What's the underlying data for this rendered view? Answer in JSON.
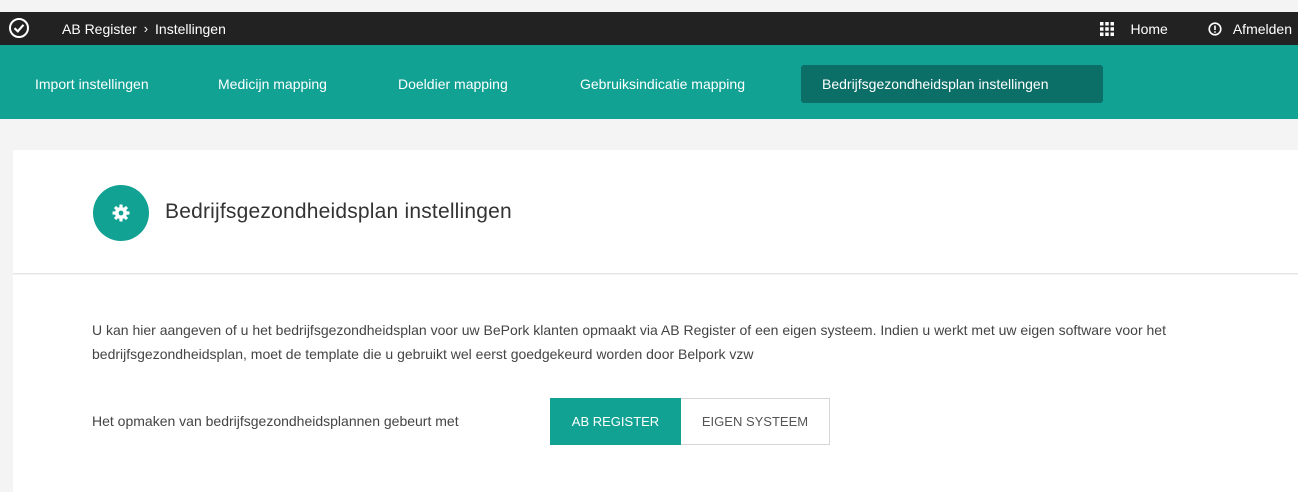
{
  "topbar": {
    "breadcrumb": [
      "AB Register",
      "Instellingen"
    ],
    "separator": "›",
    "home_label": "Home",
    "logout_label": "Afmelden"
  },
  "tabs": [
    {
      "label": "Import instellingen",
      "active": false
    },
    {
      "label": "Medicijn mapping",
      "active": false
    },
    {
      "label": "Doeldier mapping",
      "active": false
    },
    {
      "label": "Gebruiksindicatie mapping",
      "active": false
    },
    {
      "label": "Bedrijfsgezondheidsplan instellingen",
      "active": true
    }
  ],
  "page": {
    "title": "Bedrijfsgezondheidsplan instellingen",
    "description": "U kan hier aangeven of u het bedrijfsgezondheidsplan voor uw BePork klanten opmaakt via AB Register of een eigen systeem. Indien u werkt met uw eigen software voor het bedrijfsgezondheidsplan, moet de template die u gebruikt wel eerst goedgekeurd worden door Belpork vzw",
    "setting_label": "Het opmaken van bedrijfsgezondheidsplannen gebeurt met",
    "options": [
      "AB REGISTER",
      "EIGEN SYSTEEM"
    ],
    "selected_option": "AB REGISTER"
  },
  "colors": {
    "accent": "#11a294",
    "accent_dark": "#0b6f67",
    "topbar": "#222222"
  },
  "icons": [
    "check-circle-icon",
    "apps-grid-icon",
    "power-icon",
    "gear-icon"
  ]
}
